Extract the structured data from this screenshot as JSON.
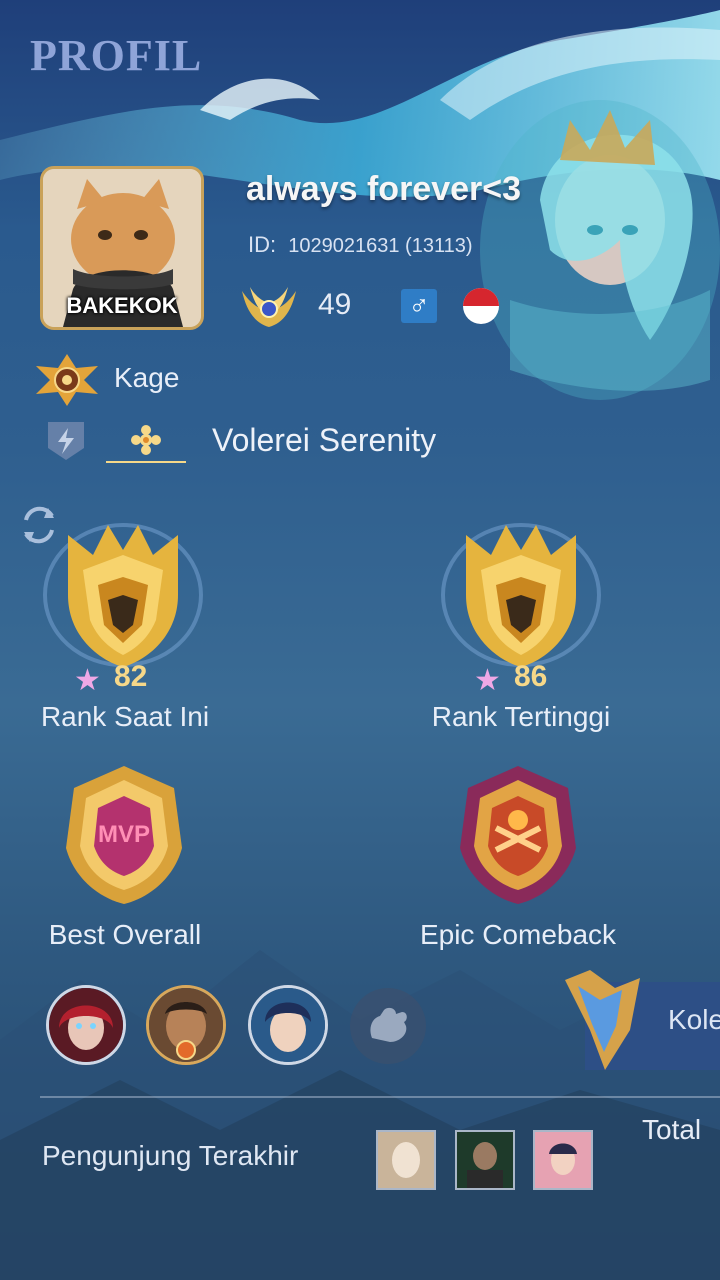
{
  "page": {
    "title": "PROFIL"
  },
  "profile": {
    "avatar_label": "BAKEKOK",
    "username": "always forever<3",
    "id_label": "ID:",
    "id_value": "1029021631 (13113)",
    "level": "49",
    "gender_icon": "male-icon",
    "flag_icon": "indonesia-flag-icon"
  },
  "title_badge": {
    "label": "Kage"
  },
  "skin": {
    "name": "Volerei Serenity"
  },
  "ranks": {
    "current": {
      "stars": "82",
      "label": "Rank Saat Ini"
    },
    "highest": {
      "stars": "86",
      "label": "Rank Tertinggi"
    }
  },
  "medals": {
    "best": {
      "label": "Best Overall"
    },
    "epic": {
      "label": "Epic Comeback"
    }
  },
  "heroes": {
    "more_icon": "hand-icon"
  },
  "collection": {
    "label": "Kolek"
  },
  "visitors": {
    "label": "Pengunjung Terakhir"
  },
  "total": {
    "label": "Total"
  },
  "colors": {
    "accent_gold": "#f6d889",
    "title": "#8fa4d8",
    "male_blue": "#2f7dc6"
  }
}
